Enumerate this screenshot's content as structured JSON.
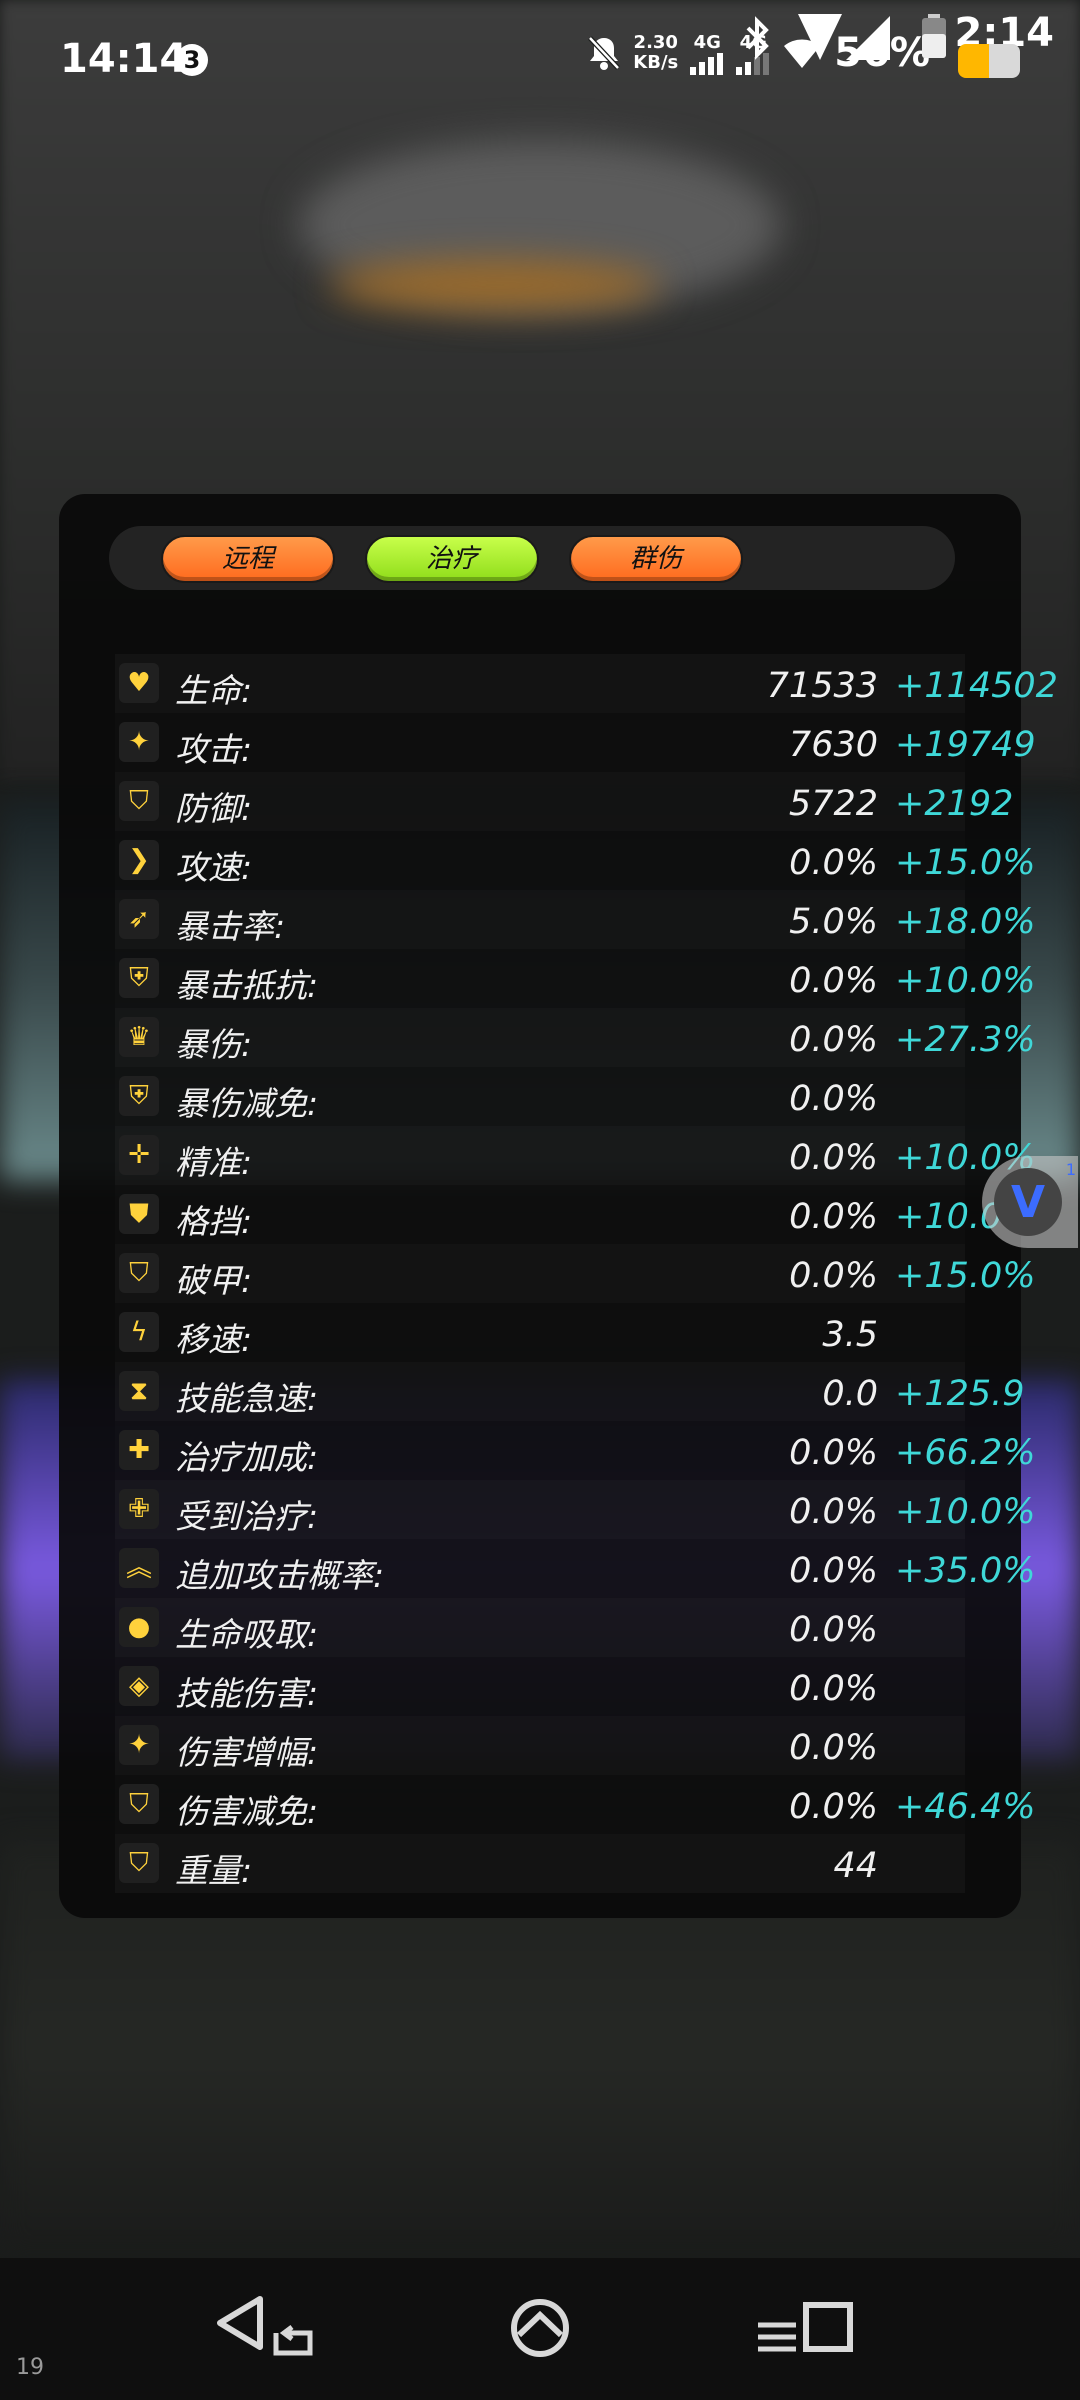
{
  "status_bar": {
    "time": "14:14",
    "notification_count": "3",
    "net_speed_value": "2.30",
    "net_speed_unit": "KB/s",
    "sim1": "4G",
    "sim2": "4G",
    "battery": "56%",
    "overlay_time": "2:14"
  },
  "tags": [
    {
      "label": "远程",
      "color": "#ff7a2a"
    },
    {
      "label": "治疗",
      "color": "#a6ef2a"
    },
    {
      "label": "群伤",
      "color": "#ff7a2a"
    }
  ],
  "stats": [
    {
      "icon": "heart-icon",
      "label": "生命:",
      "base": "71533",
      "bonus": "+114502"
    },
    {
      "icon": "sparkle-icon",
      "label": "攻击:",
      "base": "7630",
      "bonus": "+19749"
    },
    {
      "icon": "shield-icon",
      "label": "防御:",
      "base": "5722",
      "bonus": "+2192"
    },
    {
      "icon": "chevron-right-icon",
      "label": "攻速:",
      "base": "0.0%",
      "bonus": "+15.0%"
    },
    {
      "icon": "feather-icon",
      "label": "暴击率:",
      "base": "5.0%",
      "bonus": "+18.0%"
    },
    {
      "icon": "shield-outline-icon",
      "label": "暴击抵抗:",
      "base": "0.0%",
      "bonus": "+10.0%"
    },
    {
      "icon": "crown-icon",
      "label": "暴伤:",
      "base": "0.0%",
      "bonus": "+27.3%"
    },
    {
      "icon": "shield-half-icon",
      "label": "暴伤减免:",
      "base": "0.0%",
      "bonus": ""
    },
    {
      "icon": "crosshair-icon",
      "label": "精准:",
      "base": "0.0%",
      "bonus": "+10.0%"
    },
    {
      "icon": "shield-bolt-icon",
      "label": "格挡:",
      "base": "0.0%",
      "bonus": "+10.0%"
    },
    {
      "icon": "broken-shield-icon",
      "label": "破甲:",
      "base": "0.0%",
      "bonus": "+15.0%"
    },
    {
      "icon": "lightning-icon",
      "label": "移速:",
      "base": "3.5",
      "bonus": ""
    },
    {
      "icon": "hourglass-icon",
      "label": "技能急速:",
      "base": "0.0",
      "bonus": "+125.9"
    },
    {
      "icon": "plus-icon",
      "label": "治疗加成:",
      "base": "0.0%",
      "bonus": "+66.2%"
    },
    {
      "icon": "heal-cross-icon",
      "label": "受到治疗:",
      "base": "0.0%",
      "bonus": "+10.0%"
    },
    {
      "icon": "double-chevron-up-icon",
      "label": "追加攻击概率:",
      "base": "0.0%",
      "bonus": "+35.0%"
    },
    {
      "icon": "drop-icon",
      "label": "生命吸取:",
      "base": "0.0%",
      "bonus": ""
    },
    {
      "icon": "target-icon",
      "label": "技能伤害:",
      "base": "0.0%",
      "bonus": ""
    },
    {
      "icon": "star-burst-icon",
      "label": "伤害增幅:",
      "base": "0.0%",
      "bonus": ""
    },
    {
      "icon": "shield-icon",
      "label": "伤害减免:",
      "base": "0.0%",
      "bonus": "+46.4%"
    },
    {
      "icon": "shield-icon",
      "label": "重量:",
      "base": "44",
      "bonus": ""
    }
  ],
  "floating_button": {
    "glyph": "V",
    "count": "1"
  },
  "corner_label": "19",
  "colors": {
    "icon": "#ffd23c",
    "bonus": "#3fd8d8",
    "panel": "#0a0a0a"
  }
}
